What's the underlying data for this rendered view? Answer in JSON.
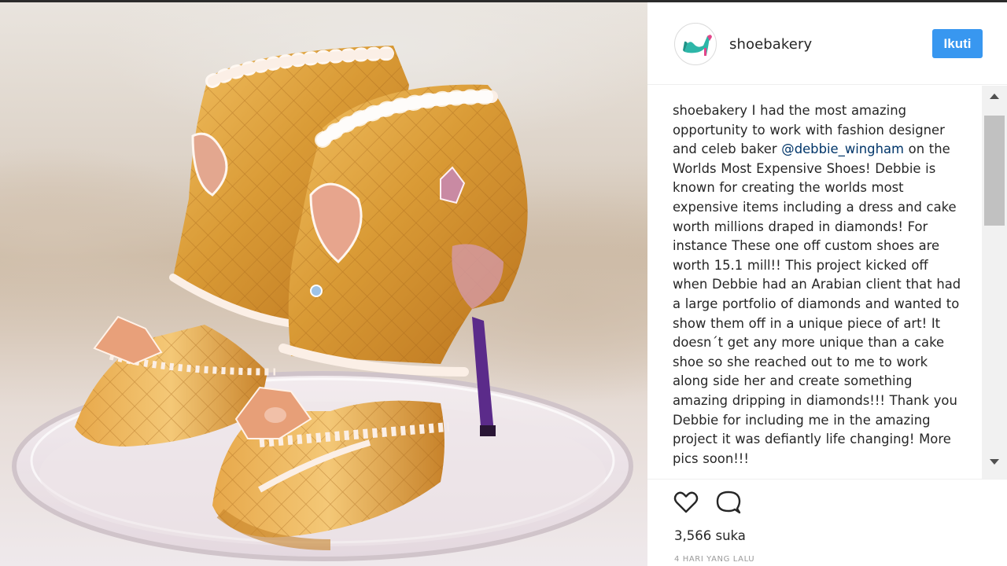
{
  "post": {
    "image_alt": "Gold cake-shoe sculpture on a glass stand",
    "username": "shoebakery",
    "follow_label": "Ikuti",
    "caption_username": "shoebakery",
    "caption_part1": " I had the most amazing opportunity to work with fashion designer and celeb baker ",
    "mention": "@debbie_wingham",
    "caption_part2": " on the Worlds Most Expensive Shoes! Debbie is known for creating the worlds most expensive items including a dress and cake worth millions draped in diamonds! For instance These one off custom shoes are worth 15.1 mill!! This project kicked off when Debbie had an Arabian client that had a large portfolio of diamonds and wanted to show them off in a unique piece of art! It doesn´t get any more unique than a cake shoe so she reached out to me to work along side her and create something amazing dripping in diamonds!!! Thank you Debbie for including me in the amazing project it was defiantly life changing! More pics soon!!!",
    "likes": "3,566 suka",
    "timestamp": "4 HARI YANG LALU"
  },
  "icons": {
    "avatar": "high-heel-shoe-icon",
    "like": "heart-outline-icon",
    "comment": "speech-bubble-icon",
    "scroll_up": "triangle-up-icon",
    "scroll_down": "triangle-down-icon"
  },
  "colors": {
    "follow_button": "#3897f0",
    "mention": "#003569",
    "timestamp": "#999999"
  }
}
